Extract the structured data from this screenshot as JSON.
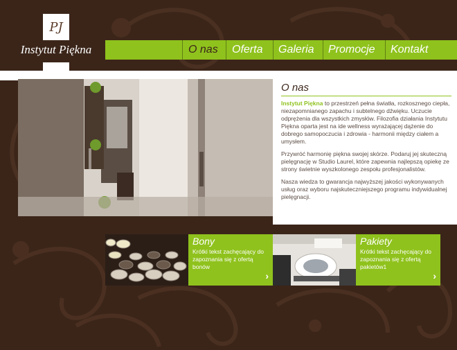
{
  "logo": {
    "monogram": "PJ",
    "name": "Instytut Piękna"
  },
  "nav": {
    "items": [
      {
        "label": "O nas",
        "active": true
      },
      {
        "label": "Oferta",
        "active": false
      },
      {
        "label": "Galeria",
        "active": false
      },
      {
        "label": "Promocje",
        "active": false
      },
      {
        "label": "Kontakt",
        "active": false
      }
    ]
  },
  "about": {
    "title": "O nas",
    "highlight": "Instytut Piękna",
    "p1_rest": " to przestrzeń pełna światła, rozkosznego ciepła, niezapomnianego zapachu i subtelnego dźwięku. Uczucie odprężenia dla wszystkich zmysłów. Filozofia działania Instytutu Piękna oparta jest na ide wellness wyrażającej dążenie do dobrego samopoczucia i zdrowia - harmonii między ciałem a umysłem.",
    "p2": "Przywróć harmonię piękna swojej skórze. Podaruj jej skuteczną pielęgnację w Studio Laurel, które zapewnia najlepszą opiekę ze strony świetnie wyszkolonego zespołu profesjonalistów.",
    "p3": "Nasza wiedza to gwarancja najwyższej jakości wykonywanych usług oraz wyboru najskuteczniejszego programu indywidualnej pielęgnacji."
  },
  "cards": [
    {
      "title": "Bony",
      "text": "Krótki tekst zachęcający do zapoznania się z ofertą bonów",
      "arrow": "›"
    },
    {
      "title": "Pakiety",
      "text": "Krótki tekst zachęcający do zapoznania się z ofertą pakietów1",
      "arrow": "›"
    }
  ],
  "colors": {
    "background": "#3b2519",
    "accent": "#8fc21d",
    "text": "#5b4b43"
  }
}
